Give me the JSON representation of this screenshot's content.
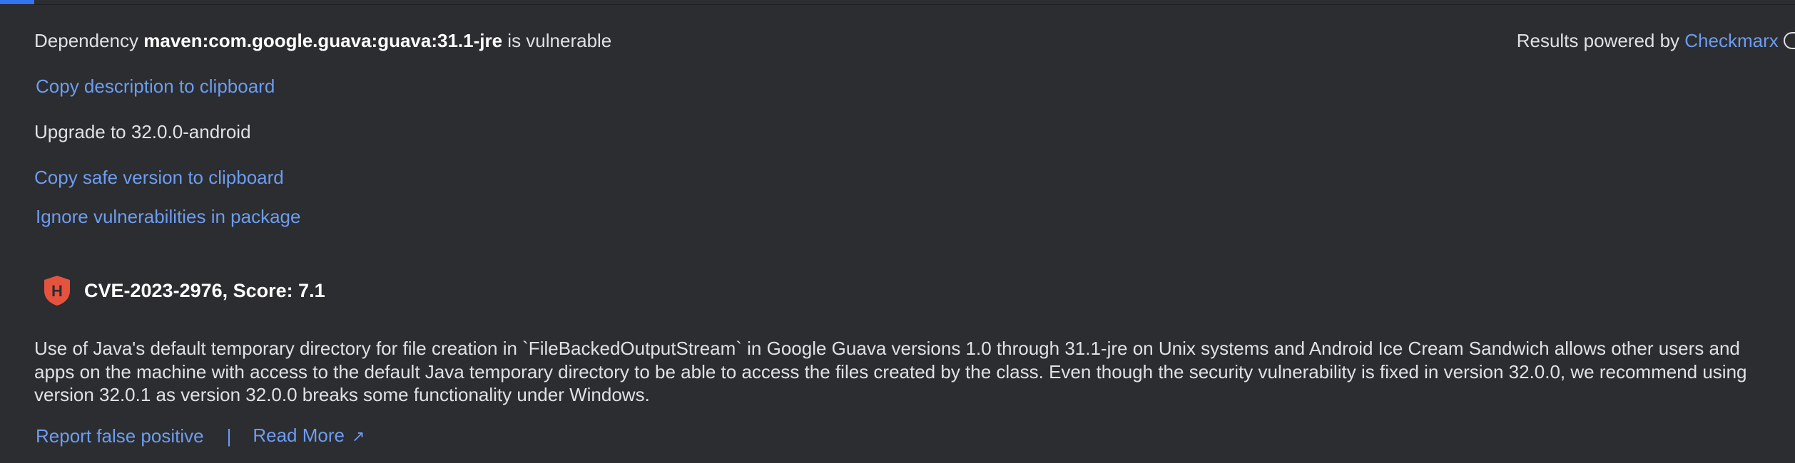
{
  "header": {
    "dependency_prefix": "Dependency",
    "dependency_name": "maven:com.google.guava:guava:31.1-jre",
    "dependency_suffix": "is vulnerable",
    "powered_by_label": "Results powered by",
    "powered_by_link": "Checkmarx"
  },
  "actions": {
    "copy_description": "Copy description to clipboard",
    "upgrade_text": "Upgrade to 32.0.0-android",
    "copy_safe_version": "Copy safe version to clipboard",
    "ignore_vulnerabilities": "Ignore vulnerabilities in package"
  },
  "vulnerability": {
    "severity_letter": "H",
    "severity_icon": "high-severity-shield-icon",
    "title": "CVE-2023-2976, Score: 7.1",
    "description": "Use of Java's default temporary directory for file creation in `FileBackedOutputStream` in Google Guava versions 1.0 through 31.1-jre on Unix systems and Android Ice Cream Sandwich allows other users and apps on the machine with access to the default Java temporary directory to be able to access the files created by the class. Even though the security vulnerability is fixed in version 32.0.0, we recommend using version 32.0.1 as version 32.0.0 breaks some functionality under Windows."
  },
  "footer": {
    "report_false_positive": "Report false positive",
    "separator": "|",
    "read_more": "Read More",
    "read_more_icon": "external-link-arrow-icon"
  },
  "colors": {
    "background": "#2b2d30",
    "link": "#6d9cf0",
    "text": "#dfe1e5",
    "severity_high": "#e5533f",
    "accent": "#3574f0"
  }
}
